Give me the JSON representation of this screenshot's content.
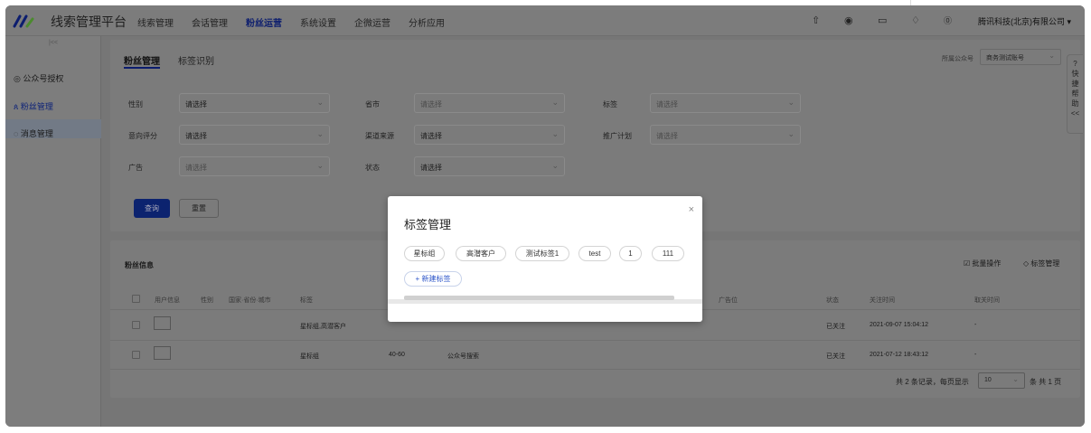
{
  "app": {
    "title": "线索管理平台"
  },
  "nav": [
    "线索管理",
    "会话管理",
    "粉丝运营",
    "系统设置",
    "企微运营",
    "分析应用"
  ],
  "nav_active_index": 2,
  "header": {
    "company": "腾讯科技(北京)有限公司",
    "company_caret": "▾",
    "icons": [
      "upload-icon",
      "feed-icon",
      "book-icon",
      "bell-icon",
      "help-icon"
    ]
  },
  "sidebar": {
    "collapse": "|<<",
    "items": [
      {
        "icon": "◎",
        "label": "公众号授权"
      },
      {
        "icon": "ጰ",
        "label": "粉丝管理"
      },
      {
        "icon": "◌",
        "label": "消息管理"
      }
    ],
    "active_index": 1
  },
  "tabs": [
    "粉丝管理",
    "标签识别"
  ],
  "account": {
    "label": "所属公众号",
    "value": "商务测试账号"
  },
  "filters": {
    "gender": {
      "label": "性别",
      "value": "请选择"
    },
    "province": {
      "label": "省市",
      "value": "请选择"
    },
    "tag": {
      "label": "标签",
      "value": "请选择"
    },
    "intent": {
      "label": "意向评分",
      "value": "请选择"
    },
    "channel": {
      "label": "渠道来源",
      "value": "请选择"
    },
    "campaign": {
      "label": "推广计划",
      "value": "请选择"
    },
    "ad": {
      "label": "广告",
      "value": "请选择"
    },
    "status": {
      "label": "状态",
      "value": "请选择"
    }
  },
  "buttons": {
    "query": "查询",
    "reset": "重置"
  },
  "fans": {
    "title": "粉丝信息",
    "batch": "批量操作",
    "tag_manage": "标签管理",
    "columns": [
      "用户信息",
      "性别",
      "国家·省份·城市",
      "标签",
      "广告位",
      "状态",
      "关注时间",
      "取关时间"
    ],
    "rows": [
      {
        "tags": "星标组,高潜客户",
        "score": "",
        "channel": "",
        "status": "已关注",
        "follow_time": "2021-09-07 15:04:12",
        "unfollow_time": "-"
      },
      {
        "tags": "星标组",
        "score": "40-60",
        "channel": "公众号搜索",
        "status": "已关注",
        "follow_time": "2021-07-12 18:43:12",
        "unfollow_time": "-"
      }
    ],
    "pagination": {
      "summary": "共 2 条记录，每页显示",
      "page_size": "10",
      "suffix": "条 共 1 页"
    }
  },
  "help_widget": {
    "icon": "?",
    "label": [
      "快",
      "捷",
      "帮",
      "助"
    ],
    "collapse": "<<"
  },
  "modal": {
    "title": "标签管理",
    "close": "×",
    "tags": [
      "星标组",
      "高潜客户",
      "测试标签1",
      "test",
      "1",
      "111"
    ],
    "add": "+ 新建标签"
  }
}
